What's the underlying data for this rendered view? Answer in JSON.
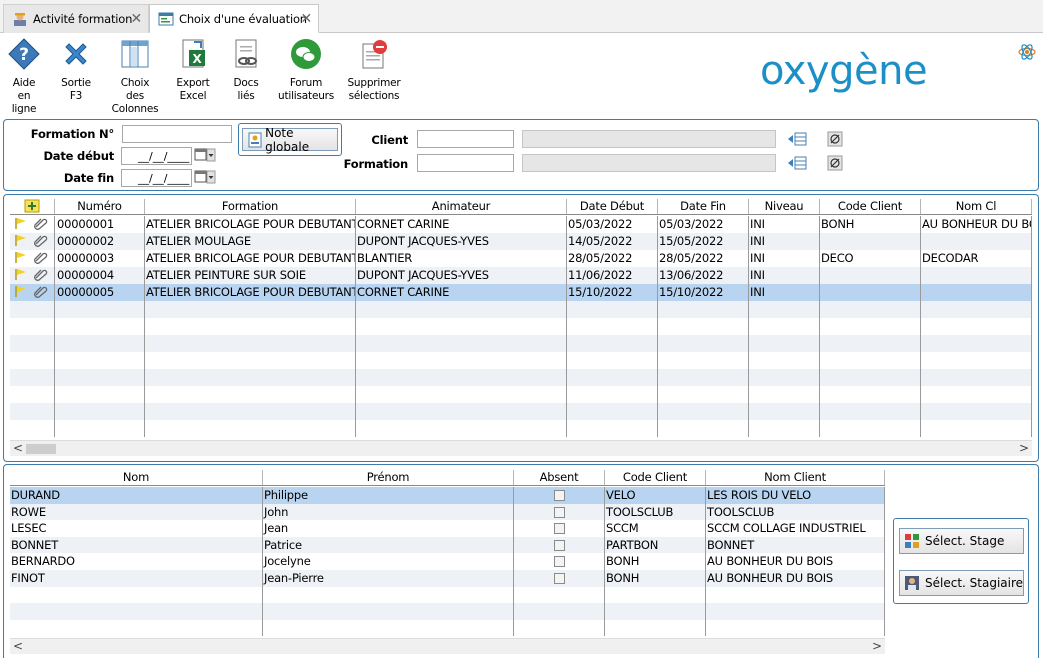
{
  "tabs": [
    {
      "label": "Activité formation",
      "icon": "worker-icon"
    },
    {
      "label": "Choix d'une évaluation",
      "icon": "form-icon"
    }
  ],
  "toolbar": [
    {
      "name": "aide-en-ligne-button",
      "lines": [
        "Aide",
        "en",
        "ligne"
      ],
      "icon": "help-icon"
    },
    {
      "name": "sortie-button",
      "lines": [
        "Sortie",
        "F3"
      ],
      "icon": "close-x-icon"
    },
    {
      "name": "choix-colonnes-button",
      "lines": [
        "Choix",
        "des",
        "Colonnes"
      ],
      "icon": "columns-icon"
    },
    {
      "name": "export-excel-button",
      "lines": [
        "Export",
        "Excel"
      ],
      "icon": "excel-icon"
    },
    {
      "name": "docs-lies-button",
      "lines": [
        "Docs",
        "liés"
      ],
      "icon": "linked-docs-icon"
    },
    {
      "name": "forum-utilisateurs-button",
      "lines": [
        "Forum",
        "utilisateurs"
      ],
      "icon": "forum-icon"
    },
    {
      "name": "supprimer-selections-button",
      "lines": [
        "Supprimer",
        "sélections"
      ],
      "icon": "delete-selection-icon"
    }
  ],
  "logo": {
    "text": "oxygène",
    "color": "#1d8fc7"
  },
  "filters": {
    "formation_no_label": "Formation N°",
    "date_debut_label": "Date début",
    "date_fin_label": "Date fin",
    "date_placeholder": "__/__/____",
    "note_globale_label": "Note globale",
    "client_label": "Client",
    "formation_label": "Formation"
  },
  "sessions": {
    "columns": [
      "Numéro",
      "Formation",
      "Animateur",
      "Date Début",
      "Date Fin",
      "Niveau",
      "Code Client",
      "Nom Cl"
    ],
    "rows": [
      [
        "00000001",
        "ATELIER BRICOLAGE POUR DEBUTANTS",
        "CORNET CARINE",
        "05/03/2022",
        "05/03/2022",
        "INI",
        "BONH",
        "AU BONHEUR DU BOIS"
      ],
      [
        "00000002",
        "ATELIER MOULAGE",
        "DUPONT JACQUES-YVES",
        "14/05/2022",
        "15/05/2022",
        "INI",
        "",
        ""
      ],
      [
        "00000003",
        "ATELIER BRICOLAGE POUR DEBUTANTS",
        "BLANTIER",
        "28/05/2022",
        "28/05/2022",
        "INI",
        "DECO",
        "DECODAR"
      ],
      [
        "00000004",
        "ATELIER PEINTURE SUR SOIE",
        "DUPONT JACQUES-YVES",
        "11/06/2022",
        "13/06/2022",
        "INI",
        "",
        ""
      ],
      [
        "00000005",
        "ATELIER BRICOLAGE POUR DEBUTANTS",
        "CORNET CARINE",
        "15/10/2022",
        "15/10/2022",
        "INI",
        "",
        ""
      ]
    ],
    "selected_row": 4
  },
  "trainees": {
    "columns": [
      "Nom",
      "Prénom",
      "Absent",
      "Code Client",
      "Nom Client"
    ],
    "rows": [
      [
        "DURAND",
        "Philippe",
        "",
        "VELO",
        "LES ROIS DU VELO"
      ],
      [
        "ROWE",
        "John",
        "",
        "TOOLSCLUB",
        "TOOLSCLUB"
      ],
      [
        "LESEC",
        "Jean",
        "",
        "SCCM",
        "SCCM COLLAGE INDUSTRIEL"
      ],
      [
        "BONNET",
        "Patrice",
        "",
        "PARTBON",
        "BONNET"
      ],
      [
        "BERNARDO",
        "Jocelyne",
        "",
        "BONH",
        "AU BONHEUR DU BOIS"
      ],
      [
        "FINOT",
        "Jean-Pierre",
        "",
        "BONH",
        "AU BONHEUR DU BOIS"
      ]
    ],
    "selected_row": 0
  },
  "actions": {
    "select_stage_label": "Sélect. Stage",
    "select_stagiaire_label": "Sélect. Stagiaire"
  }
}
